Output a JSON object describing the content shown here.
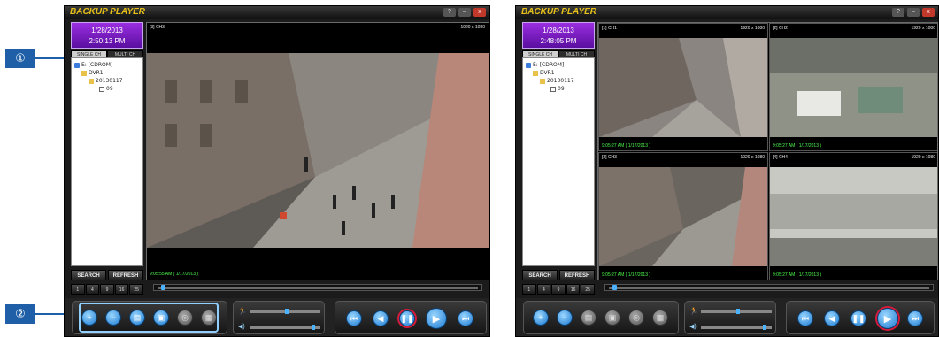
{
  "callouts": [
    "①",
    "②"
  ],
  "players": [
    {
      "title": "BACKUP PLAYER",
      "window_buttons": [
        "?",
        "–",
        "x"
      ],
      "clock": {
        "date": "1/28/2013",
        "time": "2:50:13 PM"
      },
      "tabs": [
        "SINGLE CH",
        "MULTI CH"
      ],
      "tree": [
        {
          "label": "E: [CDROM]",
          "indent": 0,
          "icon": "drive"
        },
        {
          "label": "DVR1",
          "indent": 1,
          "icon": "folder"
        },
        {
          "label": "20130117",
          "indent": 2,
          "icon": "folder"
        },
        {
          "label": "09",
          "indent": 3,
          "icon": "file"
        }
      ],
      "search_label": "SEARCH",
      "refresh_label": "REFRESH",
      "split_buttons": [
        "1",
        "4",
        "9",
        "16",
        "25"
      ],
      "channels": [
        {
          "name": "[3] CH3",
          "resolution": "1920 x 1080",
          "timestamp": "9:05:55 AM ( 1/17/2013 )"
        }
      ]
    },
    {
      "title": "BACKUP PLAYER",
      "window_buttons": [
        "?",
        "–",
        "x"
      ],
      "clock": {
        "date": "1/28/2013",
        "time": "2:48:05 PM"
      },
      "tabs": [
        "SINGLE CH",
        "MULTI CH"
      ],
      "tree": [
        {
          "label": "E: [CDROM]",
          "indent": 0,
          "icon": "drive"
        },
        {
          "label": "DVR1",
          "indent": 1,
          "icon": "folder"
        },
        {
          "label": "20130117",
          "indent": 2,
          "icon": "folder"
        },
        {
          "label": "09",
          "indent": 3,
          "icon": "file"
        }
      ],
      "search_label": "SEARCH",
      "refresh_label": "REFRESH",
      "split_buttons": [
        "1",
        "4",
        "9",
        "16",
        "25"
      ],
      "channels": [
        {
          "name": "[1] CH1",
          "resolution": "1920 x 1080",
          "timestamp": "9:05:27 AM ( 1/17/2013 )"
        },
        {
          "name": "[2] CH2",
          "resolution": "1920 x 1080",
          "timestamp": "9:05:27 AM ( 1/17/2013 )"
        },
        {
          "name": "[3] CH3",
          "resolution": "1920 x 1080",
          "timestamp": "9:05:27 AM ( 1/17/2013 )"
        },
        {
          "name": "[4] CH4",
          "resolution": "1920 x 1080",
          "timestamp": "9:05:27 AM ( 1/17/2013 )"
        }
      ]
    }
  ],
  "colors": {
    "accent": "#9a2ee0",
    "highlight": "#1f5fa8",
    "timestamp": "#4cff4c",
    "active_ring": "#d81b3a"
  }
}
